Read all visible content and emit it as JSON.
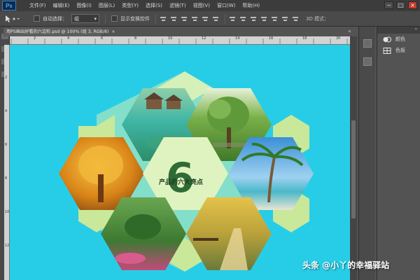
{
  "app": {
    "logo": "Ps",
    "menus": [
      "文件(F)",
      "编辑(E)",
      "图像(I)",
      "图层(L)",
      "类型(Y)",
      "选择(S)",
      "滤镜(T)",
      "视图(V)",
      "窗口(W)",
      "帮助(H)"
    ],
    "window_controls": [
      "−",
      "□",
      "×"
    ]
  },
  "options_bar": {
    "tool_icon": "move-tool-icon",
    "auto_select_label": "自动选择：",
    "auto_select_value": "组",
    "show_transform_label": "显示变换控件",
    "mode_3d_label": "3D 模式："
  },
  "document": {
    "tab_title": "用PS画出好看的六边形.psd @ 100% (组 3, RGB/8)",
    "tab_close": "×",
    "ruler_numbers_top": [
      "2",
      "4",
      "6",
      "8",
      "10",
      "12",
      "14",
      "16",
      "18",
      "20"
    ],
    "ruler_numbers_left": [
      "2",
      "4",
      "6",
      "8",
      "10",
      "12"
    ]
  },
  "artwork": {
    "center_number": "6",
    "center_text": "产品的六大亮点",
    "background_color": "#27cde6",
    "hex_light_color": "#c9e89a",
    "hex_photo_colors": {
      "resort": "#4fb6a0",
      "tree": "#7ca84a",
      "autumn": "#d88a1c",
      "palm": "#4aa3d9",
      "garden": "#4e8a3a",
      "forest": "#c2a033"
    }
  },
  "panels": {
    "items": [
      {
        "icon": "color-wheel-icon",
        "label": "颜色"
      },
      {
        "icon": "swatches-icon",
        "label": "色板"
      }
    ]
  },
  "watermark": "头条 @小丫的幸福驿站"
}
